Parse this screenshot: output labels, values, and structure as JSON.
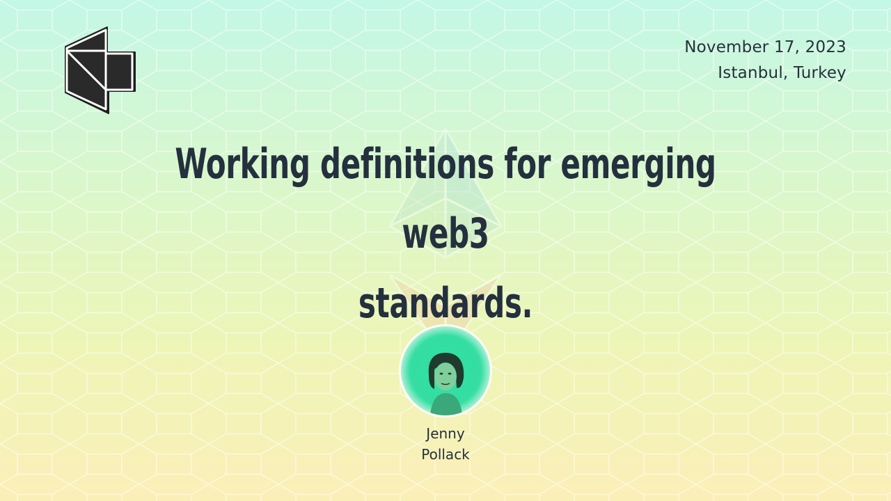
{
  "event": {
    "date": "November 17, 2023",
    "location": "Istanbul, Turkey"
  },
  "talk": {
    "title_line1": "Working definitions for emerging web3",
    "title_line2": "standards."
  },
  "speaker": {
    "first_name": "Jenny",
    "last_name": "Pollack"
  },
  "icons": {
    "logo": "devcon-book-logo-icon",
    "watermark": "ethereum-diamond-icon",
    "avatar": "speaker-avatar"
  },
  "colors": {
    "text": "#25303b",
    "avatar_bg": "#2fe0a0",
    "gradient_top": "#c3f7e6",
    "gradient_bottom": "#fbefb8"
  }
}
